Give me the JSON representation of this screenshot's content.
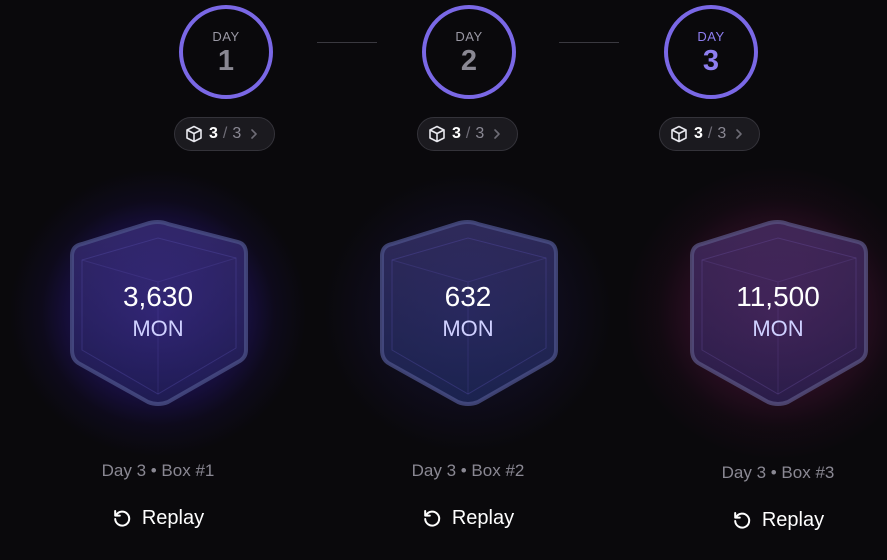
{
  "days": [
    {
      "label": "DAY",
      "number": "1",
      "active": false
    },
    {
      "label": "DAY",
      "number": "2",
      "active": false
    },
    {
      "label": "DAY",
      "number": "3",
      "active": true
    }
  ],
  "pills": [
    {
      "opened": "3",
      "separator": "/",
      "total": "3",
      "icon": "cube-icon"
    },
    {
      "opened": "3",
      "separator": "/",
      "total": "3",
      "icon": "cube-icon"
    },
    {
      "opened": "3",
      "separator": "/",
      "total": "3",
      "icon": "cube-icon"
    }
  ],
  "boxes": [
    {
      "amount": "3,630",
      "unit": "MON",
      "glow": "#5a2ee8",
      "caption": "Day 3 • Box #1",
      "replay_label": "Replay"
    },
    {
      "amount": "632",
      "unit": "MON",
      "glow": "#3a2a9a",
      "caption": "Day 3 • Box #2",
      "replay_label": "Replay"
    },
    {
      "amount": "11,500",
      "unit": "MON",
      "glow": "#7a1e5a",
      "caption": "Day 3 • Box #3",
      "replay_label": "Replay"
    }
  ],
  "colors": {
    "background": "#0a090c",
    "accent": "#7a68e6",
    "muted_text": "#8a8893"
  }
}
